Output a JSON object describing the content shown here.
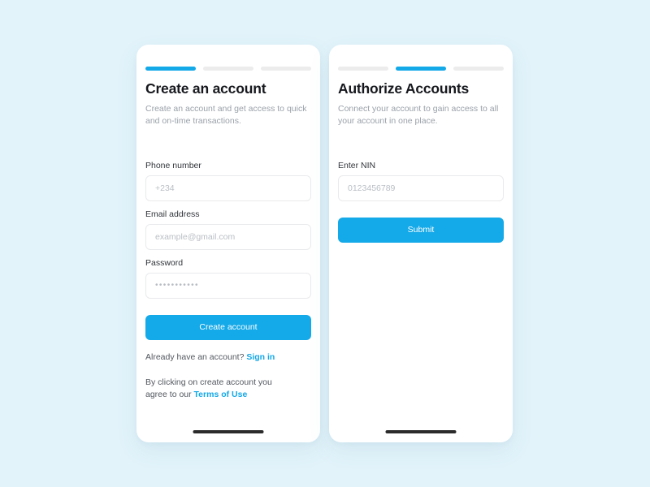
{
  "theme": {
    "background": "#e2f3fa",
    "accent": "#14a9e8",
    "card": "#ffffff",
    "step_inactive": "#ececec",
    "placeholder": "#b9bec4",
    "home_indicator": "#2b2b2b"
  },
  "screens": [
    {
      "id": "create-account",
      "steps": {
        "total": 3,
        "active_index": 0
      },
      "title": "Create an account",
      "subtitle": "Create an account and get access to quick and on-time transactions.",
      "fields": [
        {
          "label": "Phone number",
          "placeholder": "+234",
          "value": "",
          "type": "tel"
        },
        {
          "label": "Email address",
          "placeholder": "example@gmail.com",
          "value": "",
          "type": "email"
        },
        {
          "label": "Password",
          "placeholder": "•••••••••••",
          "value": "",
          "type": "password"
        }
      ],
      "submit_label": "Create account",
      "signin_prompt": "Already have an account?",
      "signin_link": "Sign in",
      "terms_prefix": "By clicking on create account you agree to our",
      "terms_link": "Terms of Use"
    },
    {
      "id": "authorize-accounts",
      "steps": {
        "total": 3,
        "active_index": 1
      },
      "title": "Authorize Accounts",
      "subtitle": "Connect your account to gain access to all your account in one place.",
      "fields": [
        {
          "label": "Enter NIN",
          "placeholder": "0123456789",
          "value": "",
          "type": "text"
        }
      ],
      "submit_label": "Submit"
    }
  ]
}
